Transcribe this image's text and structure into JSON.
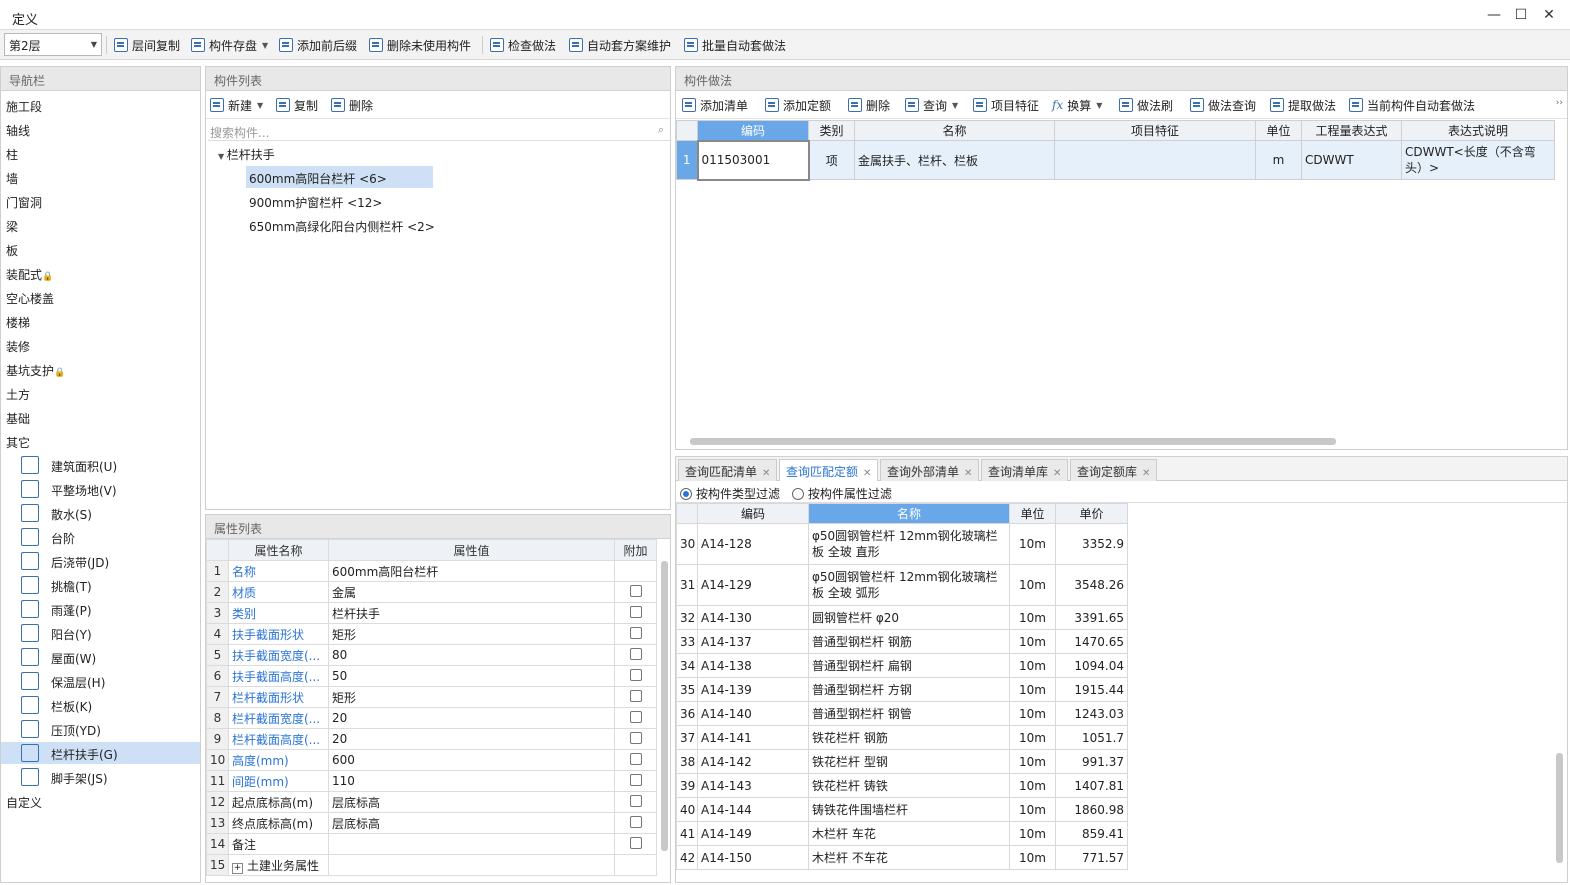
{
  "window": {
    "title": "定义",
    "min": "—",
    "max": "☐",
    "close": "✕"
  },
  "toolbar": {
    "floor": "第2层",
    "items": [
      "层间复制",
      "构件存盘",
      "添加前后缀",
      "删除未使用构件",
      "检查做法",
      "自动套方案维护",
      "批量自动套做法"
    ]
  },
  "nav": {
    "title": "导航栏",
    "items": [
      "施工段",
      "轴线",
      "柱",
      "墙",
      "门窗洞",
      "梁",
      "板",
      "装配式",
      "空心楼盖",
      "楼梯",
      "装修",
      "基坑支护",
      "土方",
      "基础",
      "其它"
    ],
    "lock_icon": "🔒",
    "sub": [
      "建筑面积(U)",
      "平整场地(V)",
      "散水(S)",
      "台阶",
      "后浇带(JD)",
      "挑檐(T)",
      "雨蓬(P)",
      "阳台(Y)",
      "屋面(W)",
      "保温层(H)",
      "栏板(K)",
      "压顶(YD)",
      "栏杆扶手(G)",
      "脚手架(JS)"
    ],
    "last": "自定义"
  },
  "component_list": {
    "title": "构件列表",
    "new": "新建",
    "copy": "复制",
    "delete": "删除",
    "search_placeholder": "搜索构件...",
    "group": "栏杆扶手",
    "items": [
      "600mm高阳台栏杆 <6>",
      "900mm护窗栏杆 <12>",
      "650mm高绿化阳台内侧栏杆 <2>"
    ]
  },
  "props": {
    "title": "属性列表",
    "headers": [
      "属性名称",
      "属性值",
      "附加"
    ],
    "rows": [
      {
        "n": "1",
        "name": "名称",
        "val": "600mm高阳台栏杆"
      },
      {
        "n": "2",
        "name": "材质",
        "val": "金属"
      },
      {
        "n": "3",
        "name": "类别",
        "val": "栏杆扶手"
      },
      {
        "n": "4",
        "name": "扶手截面形状",
        "val": "矩形"
      },
      {
        "n": "5",
        "name": "扶手截面宽度(...",
        "val": "80"
      },
      {
        "n": "6",
        "name": "扶手截面高度(...",
        "val": "50"
      },
      {
        "n": "7",
        "name": "栏杆截面形状",
        "val": "矩形"
      },
      {
        "n": "8",
        "name": "栏杆截面宽度(...",
        "val": "20"
      },
      {
        "n": "9",
        "name": "栏杆截面高度(...",
        "val": "20"
      },
      {
        "n": "10",
        "name": "高度(mm)",
        "val": "600"
      },
      {
        "n": "11",
        "name": "间距(mm)",
        "val": "110"
      },
      {
        "n": "12",
        "name": "起点底标高(m)",
        "val": "层底标高"
      },
      {
        "n": "13",
        "name": "终点底标高(m)",
        "val": "层底标高"
      },
      {
        "n": "14",
        "name": "备注",
        "val": ""
      },
      {
        "n": "15",
        "name": "土建业务属性",
        "val": ""
      }
    ]
  },
  "method": {
    "title": "构件做法",
    "toolbar": [
      "添加清单",
      "添加定额",
      "删除",
      "查询",
      "项目特征",
      "换算",
      "做法刷",
      "做法查询",
      "提取做法",
      "当前构件自动套做法"
    ],
    "headers": [
      "编码",
      "类别",
      "名称",
      "项目特征",
      "单位",
      "工程量表达式",
      "表达式说明"
    ],
    "row": {
      "n": "1",
      "code": "011503001",
      "type": "项",
      "name": "金属扶手、栏杆、栏板",
      "feature": "",
      "unit": "m",
      "expr": "CDWWT",
      "desc": "CDWWT<长度（不含弯头）>"
    }
  },
  "query": {
    "tabs": [
      "查询匹配清单",
      "查询匹配定额",
      "查询外部清单",
      "查询清单库",
      "查询定额库"
    ],
    "filters": [
      "按构件类型过滤",
      "按构件属性过滤"
    ],
    "headers": [
      "编码",
      "名称",
      "单位",
      "单价"
    ],
    "rows": [
      {
        "n": "30",
        "code": "A14-128",
        "name": "φ50圆钢管栏杆 12mm钢化玻璃栏板 全玻 直形",
        "unit": "10m",
        "price": "3352.9"
      },
      {
        "n": "31",
        "code": "A14-129",
        "name": "φ50圆钢管栏杆 12mm钢化玻璃栏板 全玻 弧形",
        "unit": "10m",
        "price": "3548.26"
      },
      {
        "n": "32",
        "code": "A14-130",
        "name": "圆钢管栏杆 φ20",
        "unit": "10m",
        "price": "3391.65"
      },
      {
        "n": "33",
        "code": "A14-137",
        "name": "普通型钢栏杆 钢筋",
        "unit": "10m",
        "price": "1470.65"
      },
      {
        "n": "34",
        "code": "A14-138",
        "name": "普通型钢栏杆 扁钢",
        "unit": "10m",
        "price": "1094.04"
      },
      {
        "n": "35",
        "code": "A14-139",
        "name": "普通型钢栏杆 方钢",
        "unit": "10m",
        "price": "1915.44"
      },
      {
        "n": "36",
        "code": "A14-140",
        "name": "普通型钢栏杆 钢管",
        "unit": "10m",
        "price": "1243.03"
      },
      {
        "n": "37",
        "code": "A14-141",
        "name": "铁花栏杆 钢筋",
        "unit": "10m",
        "price": "1051.7"
      },
      {
        "n": "38",
        "code": "A14-142",
        "name": "铁花栏杆 型钢",
        "unit": "10m",
        "price": "991.37"
      },
      {
        "n": "39",
        "code": "A14-143",
        "name": "铁花栏杆 铸铁",
        "unit": "10m",
        "price": "1407.81"
      },
      {
        "n": "40",
        "code": "A14-144",
        "name": "铸铁花件围墙栏杆",
        "unit": "10m",
        "price": "1860.98"
      },
      {
        "n": "41",
        "code": "A14-149",
        "name": "木栏杆 车花",
        "unit": "10m",
        "price": "859.41"
      },
      {
        "n": "42",
        "code": "A14-150",
        "name": "木栏杆 不车花",
        "unit": "10m",
        "price": "771.57"
      }
    ]
  }
}
